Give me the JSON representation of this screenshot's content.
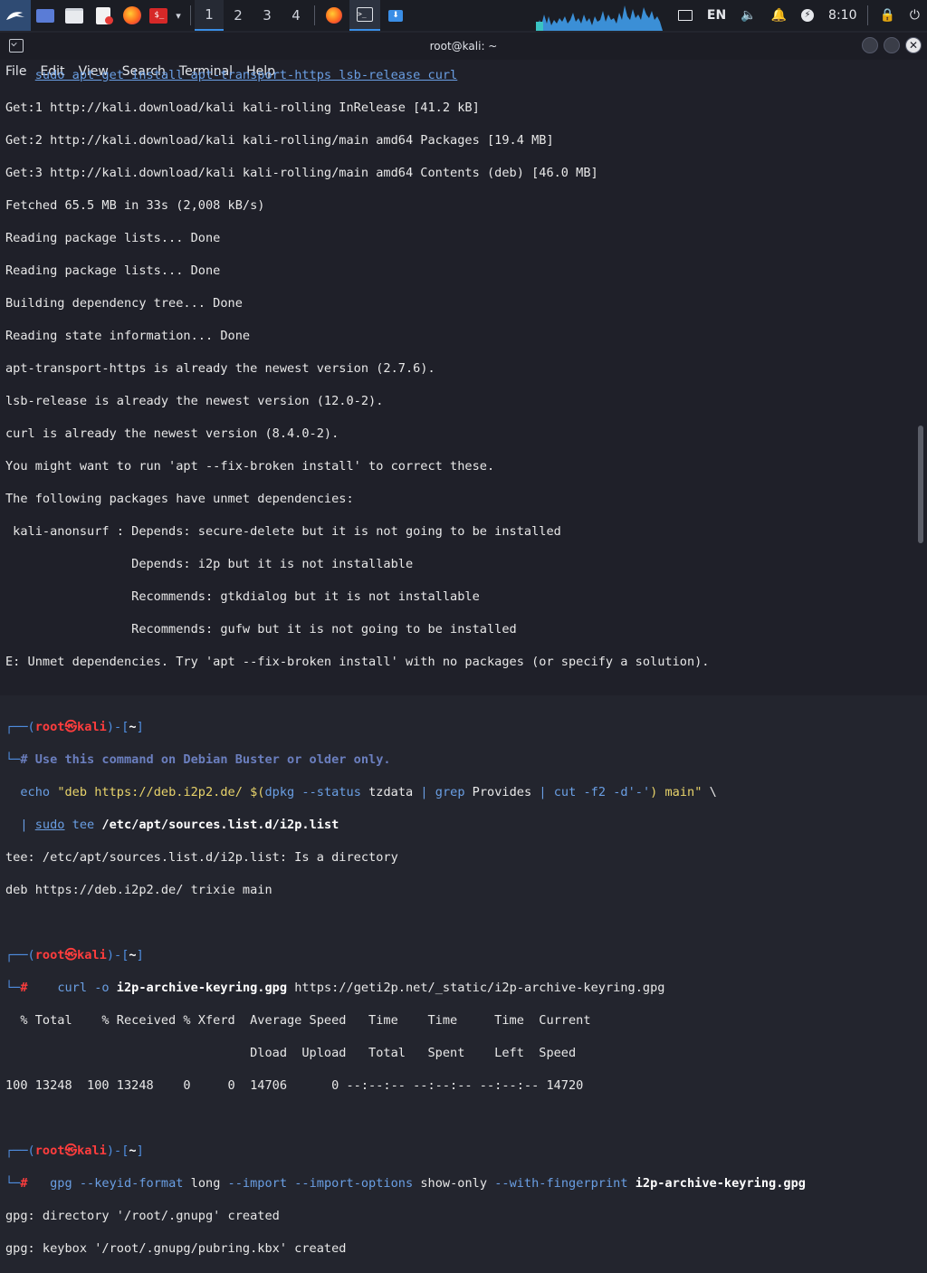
{
  "panel": {
    "workspaces": [
      "1",
      "2",
      "3",
      "4"
    ],
    "active_workspace": 0,
    "tray": {
      "language": "EN",
      "clock": "8:10"
    },
    "icons": [
      "kali-menu-icon",
      "desktop-icon",
      "files-icon",
      "text-editor-icon",
      "firefox-icon",
      "terminal-icon",
      "chevron-down-icon"
    ],
    "colors": {
      "accent": "#3a8ee6",
      "panel": "#1b1d24"
    }
  },
  "window": {
    "title": "root@kali: ~",
    "menu": [
      "File",
      "Edit",
      "View",
      "Search",
      "Terminal",
      "Help"
    ]
  },
  "terminal": {
    "prompt": {
      "user": "root",
      "symbol": "㉿",
      "host": "kali",
      "dir": "~"
    },
    "lines": {
      "l1": "sudo apt-get install apt-transport-https lsb-release curl",
      "l2": "Get:1 http://kali.download/kali kali-rolling InRelease [41.2 kB]",
      "l3": "Get:2 http://kali.download/kali kali-rolling/main amd64 Packages [19.4 MB]",
      "l4": "Get:3 http://kali.download/kali kali-rolling/main amd64 Contents (deb) [46.0 MB]",
      "l5": "Fetched 65.5 MB in 33s (2,008 kB/s)",
      "l6": "Reading package lists... Done",
      "l7": "Reading package lists... Done",
      "l8": "Building dependency tree... Done",
      "l9": "Reading state information... Done",
      "l10": "apt-transport-https is already the newest version (2.7.6).",
      "l11": "lsb-release is already the newest version (12.0-2).",
      "l12": "curl is already the newest version (8.4.0-2).",
      "l13": "You might want to run 'apt --fix-broken install' to correct these.",
      "l14": "The following packages have unmet dependencies:",
      "l15": " kali-anonsurf : Depends: secure-delete but it is not going to be installed",
      "l16": "                 Depends: i2p but it is not installable",
      "l17": "                 Recommends: gtkdialog but it is not installable",
      "l18": "                 Recommends: gufw but it is not going to be installed",
      "l19": "E: Unmet dependencies. Try 'apt --fix-broken install' with no packages (or specify a solution).",
      "c1_comment": "# Use this command on Debian Buster or older only.",
      "c1_echo": "echo",
      "c1_str1": "\"deb https://deb.i2p2.de/ ",
      "c1_sub_open": "$(",
      "c1_dpkg": "dpkg",
      "c1_status": " --status",
      "c1_tzdata": " tzdata ",
      "c1_pipe1": "|",
      "c1_grep": " grep",
      "c1_provides": " Provides ",
      "c1_pipe2": "|",
      "c1_cut": " cut",
      "c1_args": " -f2 -d'-'",
      "c1_sub_close": ")",
      "c1_str2": " main\"",
      "c1_bs": " \\",
      "c1_pipe3": "| ",
      "c1_sudo": "sudo",
      "c1_tee": " tee",
      "c1_file": " /etc/apt/sources.list.d/i2p.list",
      "o1": "tee: /etc/apt/sources.list.d/i2p.list: Is a directory",
      "o2": "deb https://deb.i2p2.de/ trixie main",
      "c2_curl": "curl",
      "c2_opt": " -o",
      "c2_file": " i2p-archive-keyring.gpg",
      "c2_url": " https://geti2p.net/_static/i2p-archive-keyring.gpg",
      "cu1": "  % Total    % Received % Xferd  Average Speed   Time    Time     Time  Current",
      "cu2": "                                 Dload  Upload   Total   Spent    Left  Speed",
      "cu3": "100 13248  100 13248    0     0  14706      0 --:--:-- --:--:-- --:--:-- 14720",
      "c3_gpg": "gpg",
      "c3_opt1": " --keyid-format",
      "c3_long": " long",
      "c3_opt2": " --import --import-options",
      "c3_show": " show-only",
      "c3_opt3": " --with-fingerprint",
      "c3_file": " i2p-archive-keyring.gpg",
      "g1": "gpg: directory '/root/.gnupg' created",
      "g2": "gpg: keybox '/root/.gnupg/pubring.kbx' created"
    }
  }
}
